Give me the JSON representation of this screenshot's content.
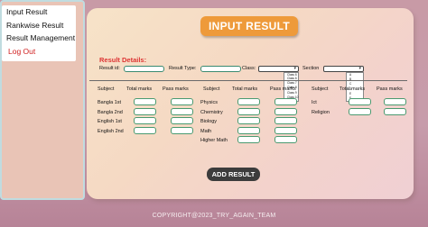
{
  "menu": {
    "items": [
      "Input Result",
      "Rankwise Result",
      "Result Management"
    ],
    "logout": "Log Out"
  },
  "page": {
    "title": "INPUT RESULT",
    "details_label": "Result Details:"
  },
  "fields": {
    "result_id": "Result id:",
    "result_type": "Result Type:",
    "class": "Class:",
    "section": "Section"
  },
  "class_options": [
    "Class 6",
    "Class 7",
    "Class 8",
    "Class 9",
    "Class 10"
  ],
  "class_options_top": "Class 6",
  "section_options": [
    "A",
    "B",
    "C",
    "D",
    "E",
    "F"
  ],
  "columns": {
    "subject": "Subject",
    "total": "Total marks",
    "pass": "Pass marks"
  },
  "col1_subjects": [
    "Bangla 1st",
    "Bangla  2nd",
    "English  1st",
    "English  2nd"
  ],
  "col2_subjects": [
    "Physics",
    "Chemistry",
    "Biology",
    "Math",
    "Higher Math"
  ],
  "col3_subjects": [
    "Ict",
    "Religion"
  ],
  "submit_label": "ADD RESULT",
  "footer": "COPYRIGHT@2023_TRY_AGAIN_TEAM",
  "colors": {
    "accent": "#ee9a3a",
    "danger": "#d33333",
    "button": "#3c3c3c"
  }
}
